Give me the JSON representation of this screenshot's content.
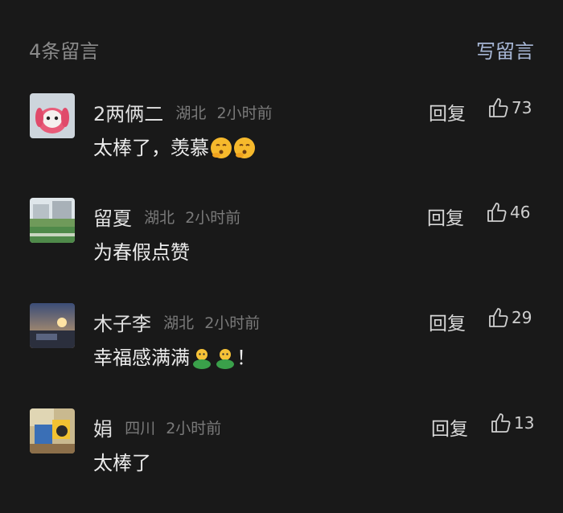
{
  "header": {
    "count_label": "4条留言",
    "write_label": "写留言"
  },
  "comments": [
    {
      "name": "2两俩二",
      "location": "湖北",
      "time": "2小时前",
      "text": "太棒了，羡慕",
      "emoji": [
        "kiss-face",
        "kiss-face"
      ],
      "reply_label": "回复",
      "likes": "73"
    },
    {
      "name": "留夏",
      "location": "湖北",
      "time": "2小时前",
      "text": "为春假点赞",
      "reply_label": "回复",
      "likes": "46"
    },
    {
      "name": "木子李",
      "location": "湖北",
      "time": "2小时前",
      "text": "幸福感满满",
      "emoji": [
        "green-person",
        "green-person"
      ],
      "text_suffix": "！",
      "reply_label": "回复",
      "likes": "29"
    },
    {
      "name": "娟",
      "location": "四川",
      "time": "2小时前",
      "text": "太棒了",
      "reply_label": "回复",
      "likes": "13"
    }
  ],
  "colors": {
    "background": "#191919",
    "accent": "#a7b7d6",
    "muted": "#7a7a7a"
  }
}
